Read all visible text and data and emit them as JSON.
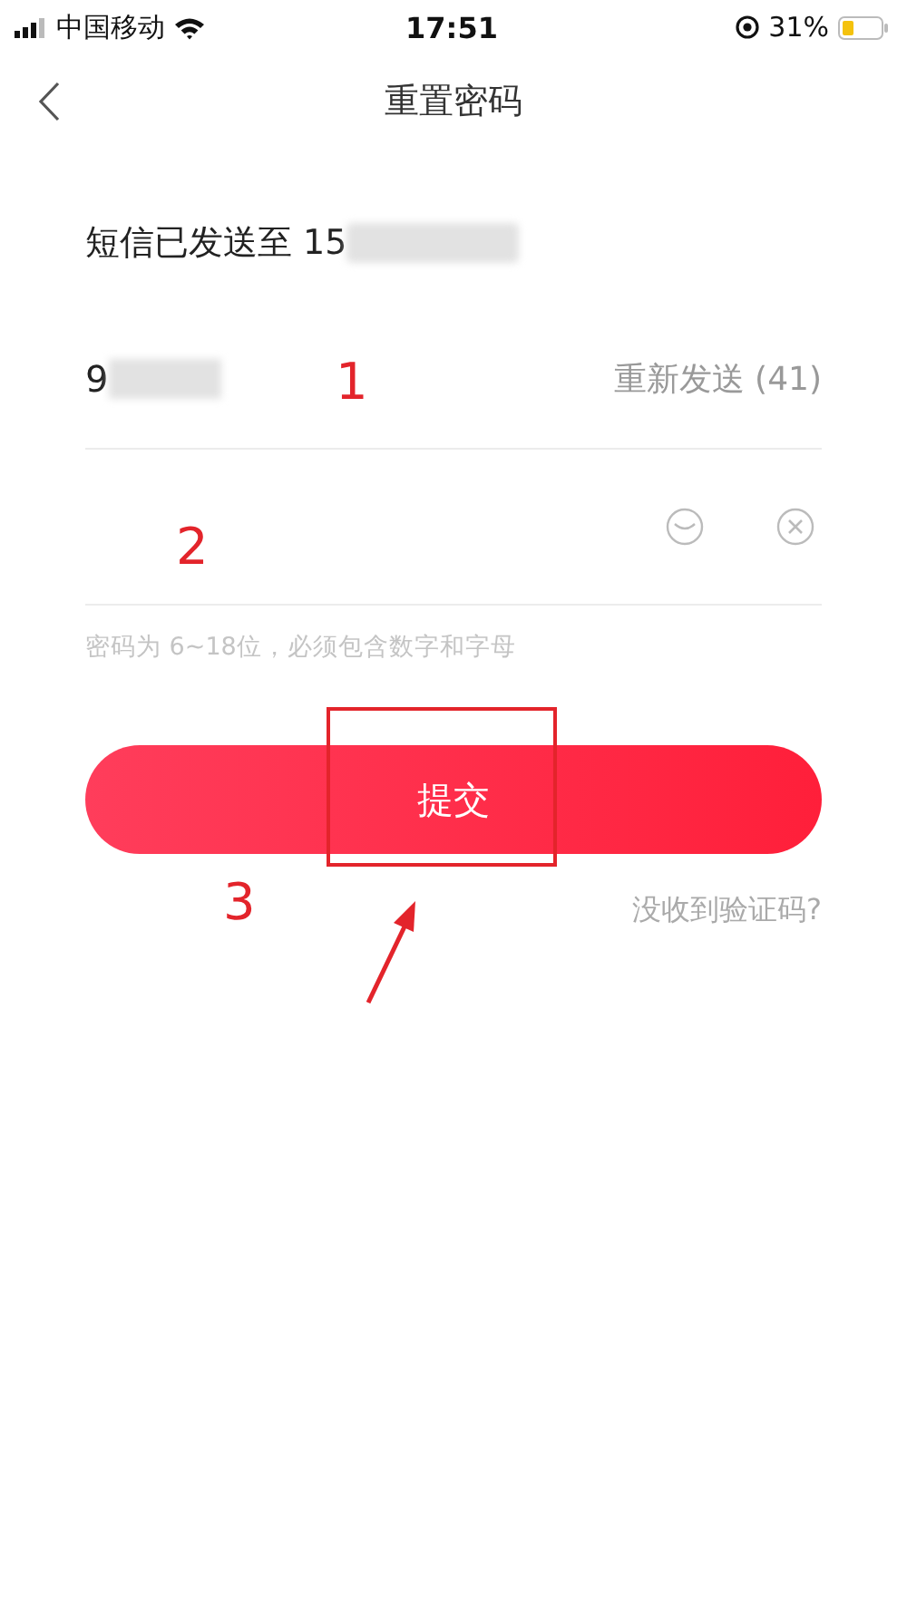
{
  "status_bar": {
    "carrier": "中国移动",
    "time": "17:51",
    "battery": "31%"
  },
  "nav": {
    "title": "重置密码"
  },
  "sms_notice": "短信已发送至 15",
  "code_field": {
    "value": "9",
    "resend": "重新发送 (41)"
  },
  "hint": "密码为 6~18位，必须包含数字和字母",
  "submit": "提交",
  "help_link": "没收到验证码?",
  "annotations": [
    {
      "kind": "number",
      "text": "1"
    },
    {
      "kind": "number",
      "text": "2"
    },
    {
      "kind": "number",
      "text": "3"
    },
    {
      "kind": "box"
    },
    {
      "kind": "arrow"
    }
  ]
}
